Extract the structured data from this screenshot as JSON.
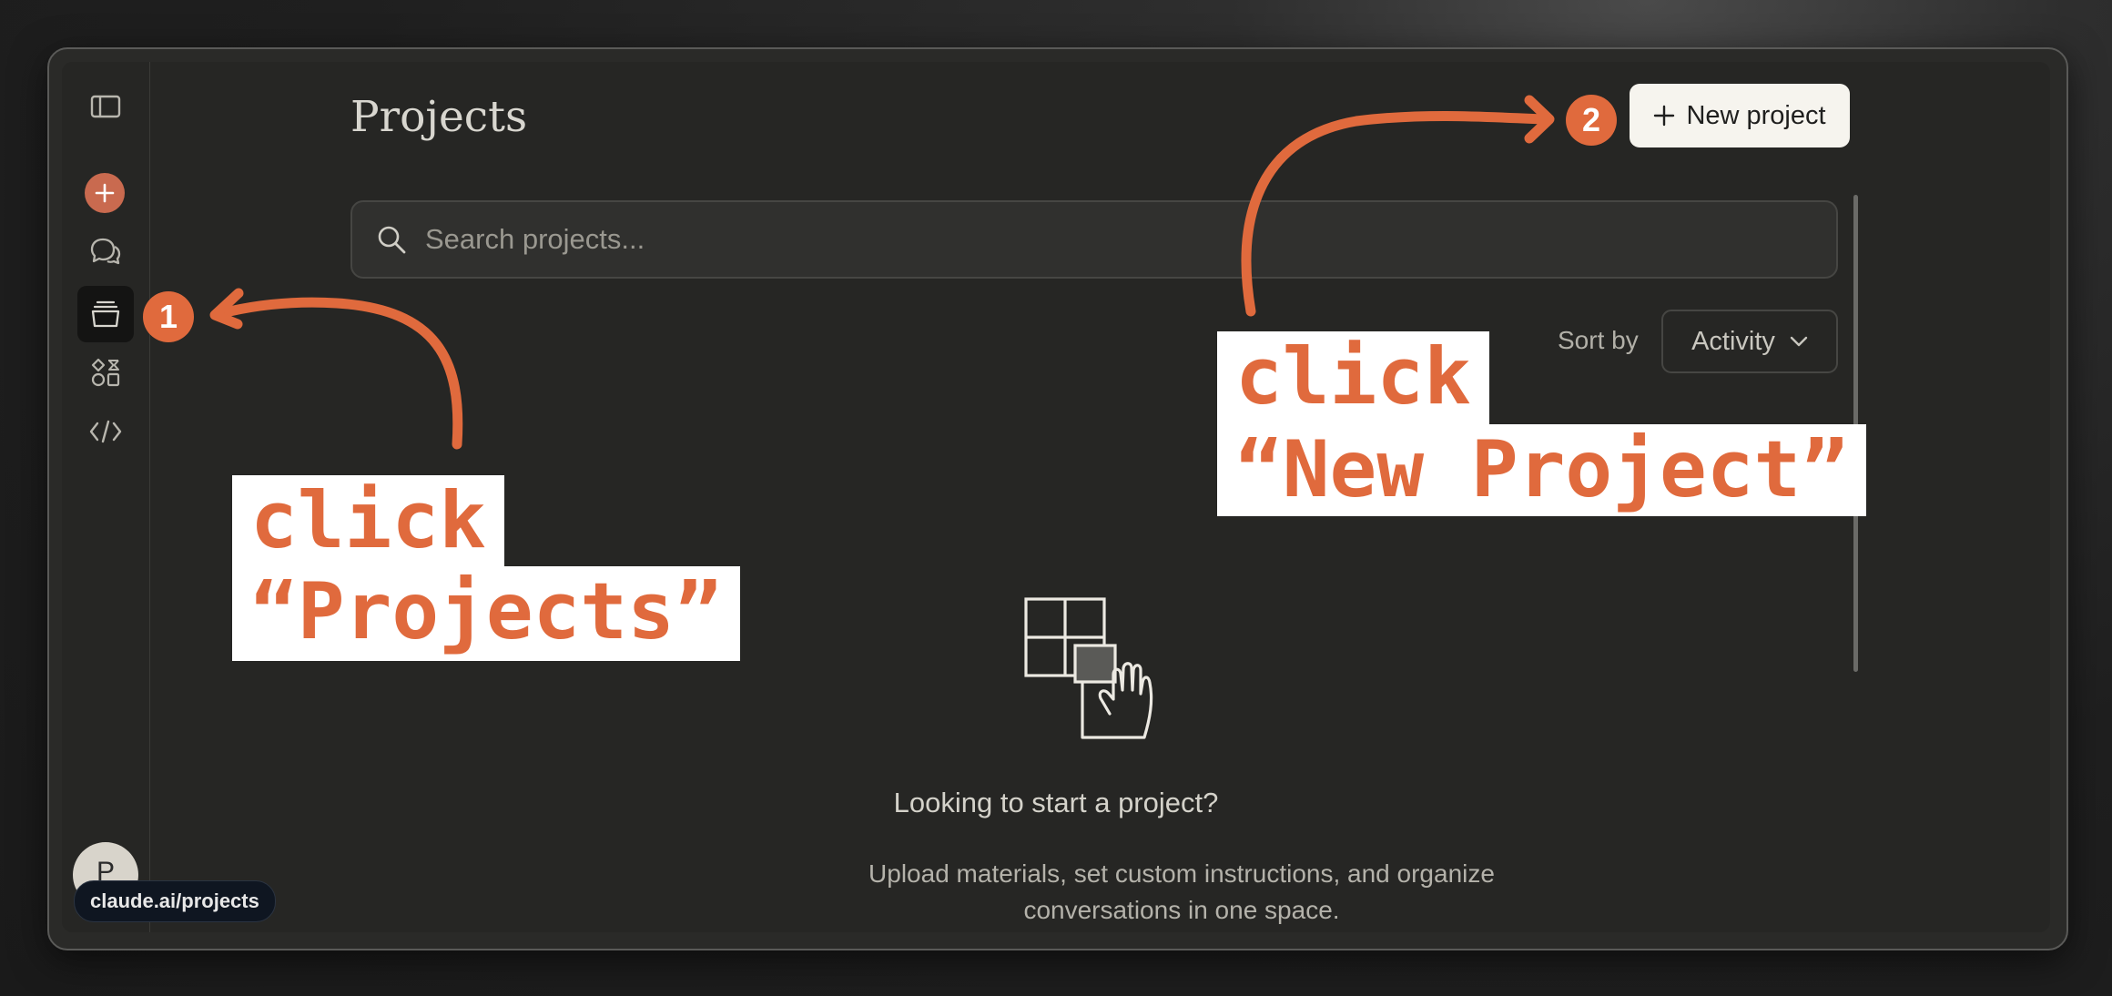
{
  "page": {
    "title": "Projects"
  },
  "sidebar": {
    "items": [
      {
        "name": "sidebar-toggle-icon"
      },
      {
        "name": "new-chat-icon"
      },
      {
        "name": "chats-icon"
      },
      {
        "name": "projects-icon"
      },
      {
        "name": "artifacts-icon"
      },
      {
        "name": "code-icon"
      }
    ],
    "avatar_initial": "P",
    "url_tooltip": "claude.ai/projects"
  },
  "header": {
    "new_project_label": "New project"
  },
  "search": {
    "placeholder": "Search projects..."
  },
  "sort": {
    "label": "Sort by",
    "value": "Activity"
  },
  "empty_state": {
    "title": "Looking to start a project?",
    "description_line1": "Upload materials, set custom instructions, and organize",
    "description_line2": "conversations in one space."
  },
  "annotations": {
    "step1_number": "1",
    "step1_line1": "click",
    "step1_line2": "“Projects”",
    "step2_number": "2",
    "step2_line1": "click",
    "step2_line2": "“New Project”"
  },
  "colors": {
    "accent_orange": "#e06a3d",
    "sidebar_new_button": "#c96a4f",
    "background": "#262624",
    "primary_button_bg": "#f6f4ee"
  }
}
